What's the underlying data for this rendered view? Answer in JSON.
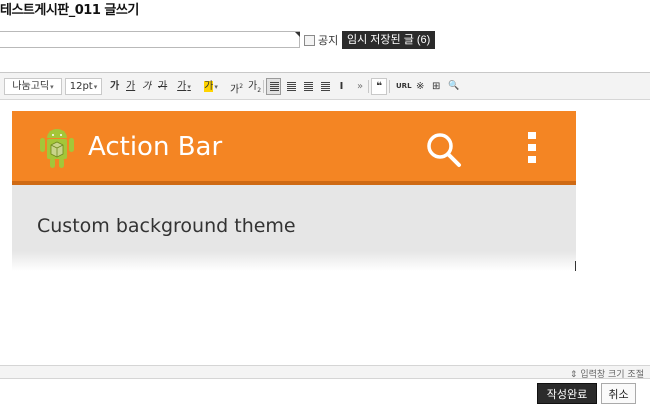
{
  "page": {
    "title": "테스트게시판_011 글쓰기"
  },
  "form": {
    "title_value": "",
    "notice_label": "공지",
    "temp_saved_label": "임시 저장된 글 (6)"
  },
  "toolbar": {
    "font_family": "나눔고딕",
    "font_size": "12pt",
    "bold": "가",
    "underline": "가",
    "italic": "가",
    "strike": "가",
    "font_color": "가",
    "bg_color": "가",
    "superscript": "가",
    "subscript": "가",
    "more": "»",
    "quote": "❝",
    "url": "URL",
    "special_char": "※",
    "table": "⊞",
    "find": "🔍"
  },
  "editor": {
    "action_bar_title": "Action Bar",
    "content_text": "Custom background theme",
    "colors": {
      "action_bar": "#f48523",
      "android": "#a4c639"
    }
  },
  "resize": {
    "label": "입력창 크기 조절"
  },
  "buttons": {
    "submit": "작성완료",
    "cancel": "취소"
  }
}
